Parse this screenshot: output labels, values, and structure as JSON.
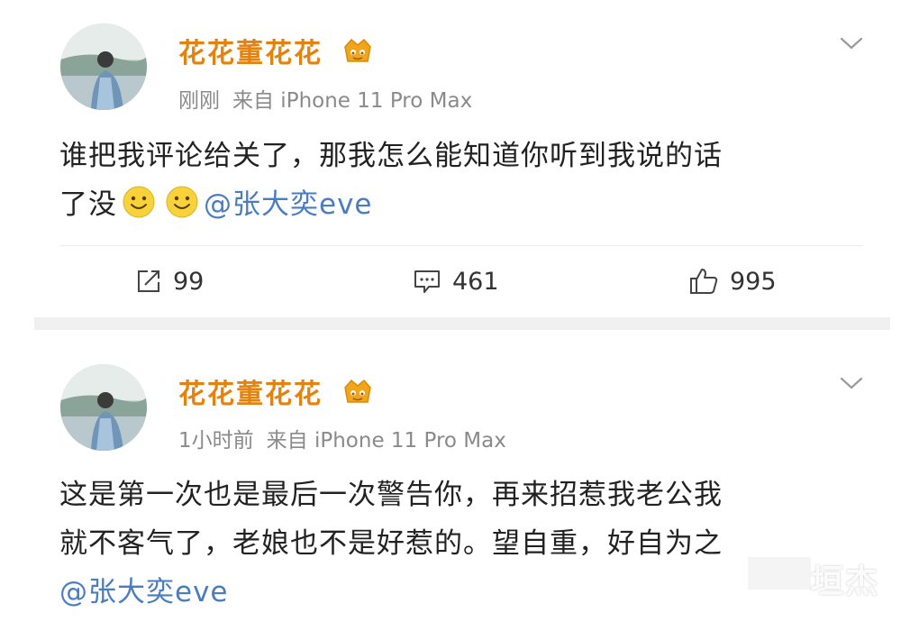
{
  "posts": [
    {
      "username": "花花董花花",
      "time": "刚刚",
      "source": "来自 iPhone 11 Pro Max",
      "content_line1": "谁把我评论给关了，那我怎么能知道你听到我说的话",
      "content_line2_prefix": "了没",
      "mention": "@张大奕eve",
      "repost_count": "99",
      "comment_count": "461",
      "like_count": "995"
    },
    {
      "username": "花花董花花",
      "time": "1小时前",
      "source": "来自 iPhone 11 Pro Max",
      "content_line1": "这是第一次也是最后一次警告你，再来招惹我老公我",
      "content_line2": "就不客气了，老娘也不是好惹的。望自重，好自为之",
      "mention": "@张大奕eve"
    }
  ],
  "watermark": "垣杰",
  "colors": {
    "username": "#e5820e",
    "mention": "#4a7cc0",
    "meta": "#8a8a8a"
  },
  "icons": [
    "vip-crown-icon",
    "chevron-down-icon",
    "smile-emoji-icon",
    "repost-icon",
    "comment-icon",
    "like-icon"
  ]
}
